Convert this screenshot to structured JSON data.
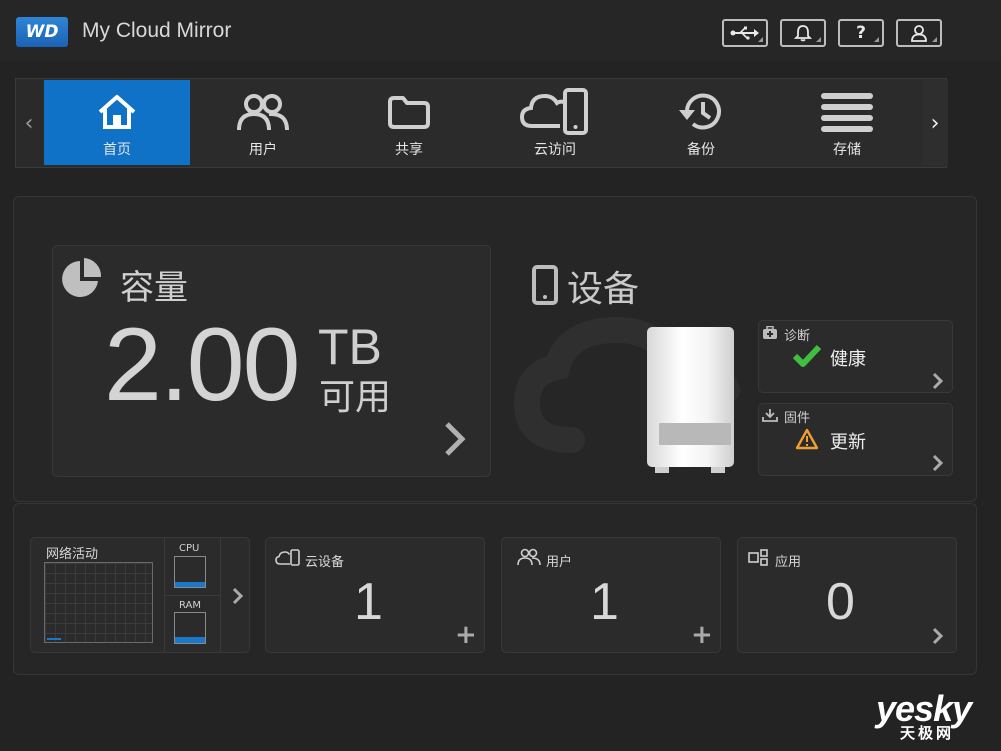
{
  "header": {
    "logo_text": "WD",
    "app_title": "My Cloud Mirror",
    "buttons": {
      "usb_icon": "usb-icon",
      "notifications_icon": "bell-icon",
      "help_label": "?",
      "user_icon": "user-icon"
    }
  },
  "nav": {
    "items": [
      {
        "label": "首页",
        "icon": "home-icon"
      },
      {
        "label": "用户",
        "icon": "users-icon"
      },
      {
        "label": "共享",
        "icon": "folder-icon"
      },
      {
        "label": "云访问",
        "icon": "cloud-access-icon"
      },
      {
        "label": "备份",
        "icon": "history-icon"
      },
      {
        "label": "存储",
        "icon": "storage-icon"
      }
    ],
    "active_index": 0,
    "active_color": "#0f72c6"
  },
  "capacity": {
    "title": "容量",
    "value": "2.00",
    "unit": "TB",
    "available_label": "可用"
  },
  "device": {
    "title": "设备",
    "diagnostics": {
      "label": "诊断",
      "status": "健康",
      "status_color": "#3fbf3f"
    },
    "firmware": {
      "label": "固件",
      "status": "更新",
      "status_color": "#f0a030"
    }
  },
  "bottom": {
    "network_activity_label": "网络活动",
    "cpu_label": "CPU",
    "ram_label": "RAM",
    "meter_color": "#1b78c8",
    "tiles": [
      {
        "label": "云设备",
        "value": "1",
        "icon": "cloud-device-icon",
        "action": "+"
      },
      {
        "label": "用户",
        "value": "1",
        "icon": "users-icon",
        "action": "+"
      },
      {
        "label": "应用",
        "value": "0",
        "icon": "apps-icon",
        "action": "›"
      }
    ]
  },
  "watermark": {
    "brand": "yesky",
    "sub": "天极网"
  }
}
